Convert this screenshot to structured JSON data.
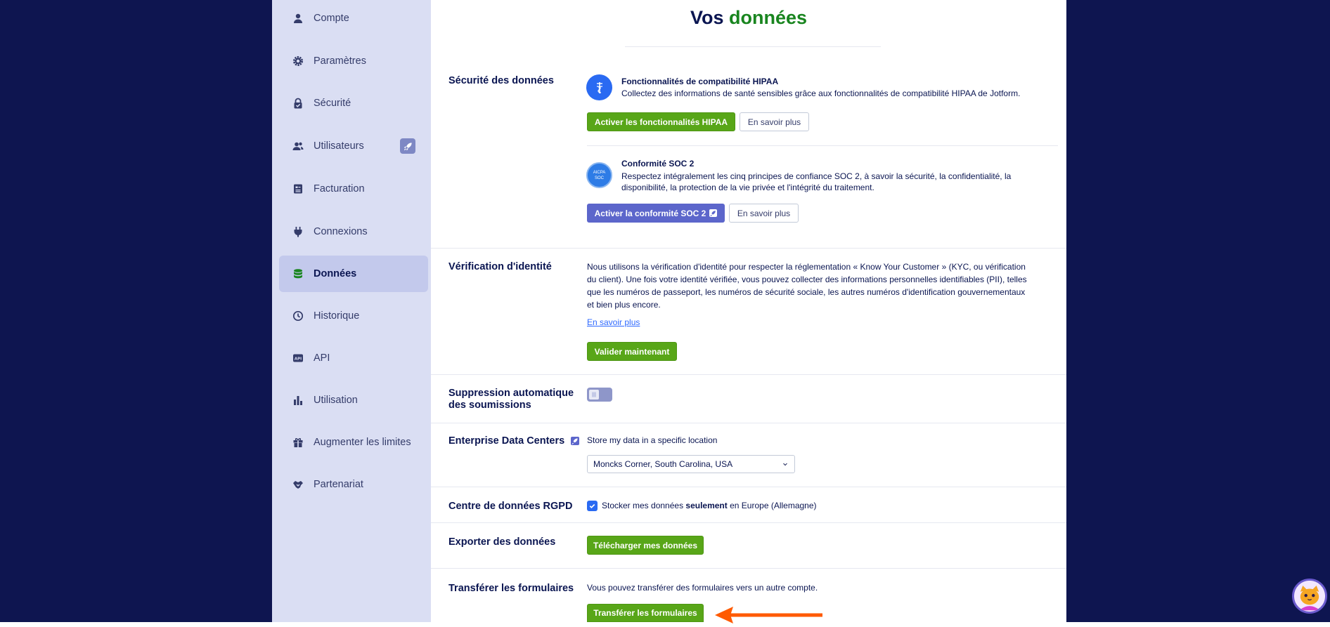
{
  "sidebar": {
    "items": [
      {
        "label": "Compte",
        "icon": "user-icon"
      },
      {
        "label": "Paramètres",
        "icon": "gear-icon"
      },
      {
        "label": "Sécurité",
        "icon": "lock-icon"
      },
      {
        "label": "Utilisateurs",
        "icon": "users-icon"
      },
      {
        "label": "Facturation",
        "icon": "invoice-icon"
      },
      {
        "label": "Connexions",
        "icon": "plug-icon"
      },
      {
        "label": "Données",
        "icon": "database-icon",
        "active": true
      },
      {
        "label": "Historique",
        "icon": "clock-icon"
      },
      {
        "label": "API",
        "icon": "api-icon"
      },
      {
        "label": "Utilisation",
        "icon": "bar-chart-icon"
      },
      {
        "label": "Augmenter les limites",
        "icon": "gift-icon"
      },
      {
        "label": "Partenariat",
        "icon": "handshake-icon"
      }
    ]
  },
  "page": {
    "title_part1": "Vos",
    "title_part2": "données"
  },
  "sections": {
    "security": {
      "label": "Sécurité des données",
      "hipaa_title": "Fonctionnalités de compatibilité HIPAA",
      "hipaa_desc": "Collectez des informations de santé sensibles grâce aux fonctionnalités de compatibilité HIPAA de Jotform.",
      "hipaa_button": "Activer les fonctionnalités HIPAA",
      "hipaa_more": "En savoir plus",
      "soc_title": "Conformité SOC 2",
      "soc_desc_1": "Respectez intégralement les cinq principes de confiance SOC 2, à savoir la sécurité, la confidentialité, la",
      "soc_desc_2": "disponibilité, la protection de la vie privée et l'intégrité du traitement.",
      "soc_button": "Activer la conformité SOC 2",
      "soc_more": "En savoir plus",
      "soc_badge_top": "AICPA",
      "soc_badge_bottom": "SOC"
    },
    "identity": {
      "label": "Vérification d'identité",
      "line1": "Nous utilisons la vérification d'identité pour respecter la réglementation « Know Your Customer » (KYC, ou vérification",
      "line2": "du client). Une fois votre identité vérifiée, vous pouvez collecter des informations personnelles identifiables (PII), telles",
      "line3": "que les numéros de passeport, les numéros de sécurité sociale, les autres numéros d'identification gouvernementaux",
      "line4": "et bien plus encore.",
      "link": "En savoir plus",
      "button": "Valider maintenant"
    },
    "auto_delete": {
      "label_line1": "Suppression automatique",
      "label_line2": "des soumissions",
      "enabled": false
    },
    "data_centers": {
      "label": "Enterprise Data Centers",
      "desc": "Store my data in a specific location",
      "selected": "Moncks Corner, South Carolina, USA"
    },
    "gdpr": {
      "label": "Centre de données RGPD",
      "text_before": "Stocker mes données",
      "text_bold": "seulement",
      "text_after": "en Europe (Allemagne)",
      "checked": true
    },
    "export": {
      "label": "Exporter des données",
      "button": "Télécharger mes données"
    },
    "transfer": {
      "label": "Transférer les formulaires",
      "desc": "Vous pouvez transférer des formulaires vers un autre compte.",
      "button": "Transférer les formulaires"
    }
  },
  "colors": {
    "navy": "#0a1551",
    "green": "#58a618",
    "title_green": "#19851f",
    "purple": "#5c66cb",
    "arrow": "#ff5a00",
    "frame": "#0e1550"
  }
}
